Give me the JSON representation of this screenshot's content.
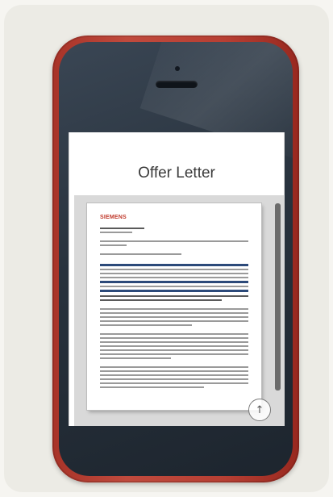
{
  "screen": {
    "title": "Offer Letter"
  },
  "document": {
    "logo_text": "SIEMENS",
    "scroll_top_icon": "arrow-up-icon"
  },
  "colors": {
    "phone_frame": "#b73f33",
    "phone_face": "#28323d",
    "accent_blue": "#2c4a7a"
  }
}
